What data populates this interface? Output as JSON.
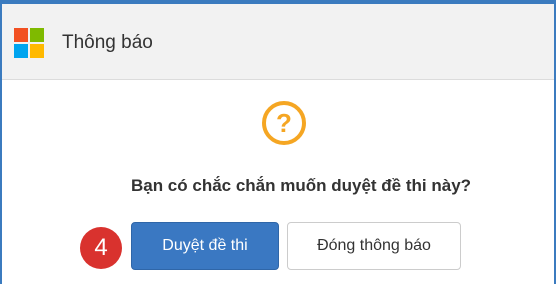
{
  "dialog": {
    "title": "Thông báo",
    "icon": "question-circle-icon",
    "message": "Bạn có chắc chắn muốn duyệt đề thi này?",
    "step_badge": "4",
    "confirm_label": "Duyệt đề thi",
    "close_label": "Đóng thông báo"
  },
  "colors": {
    "accent": "#3a78c2",
    "warning": "#f5a623",
    "badge": "#d9322e"
  }
}
